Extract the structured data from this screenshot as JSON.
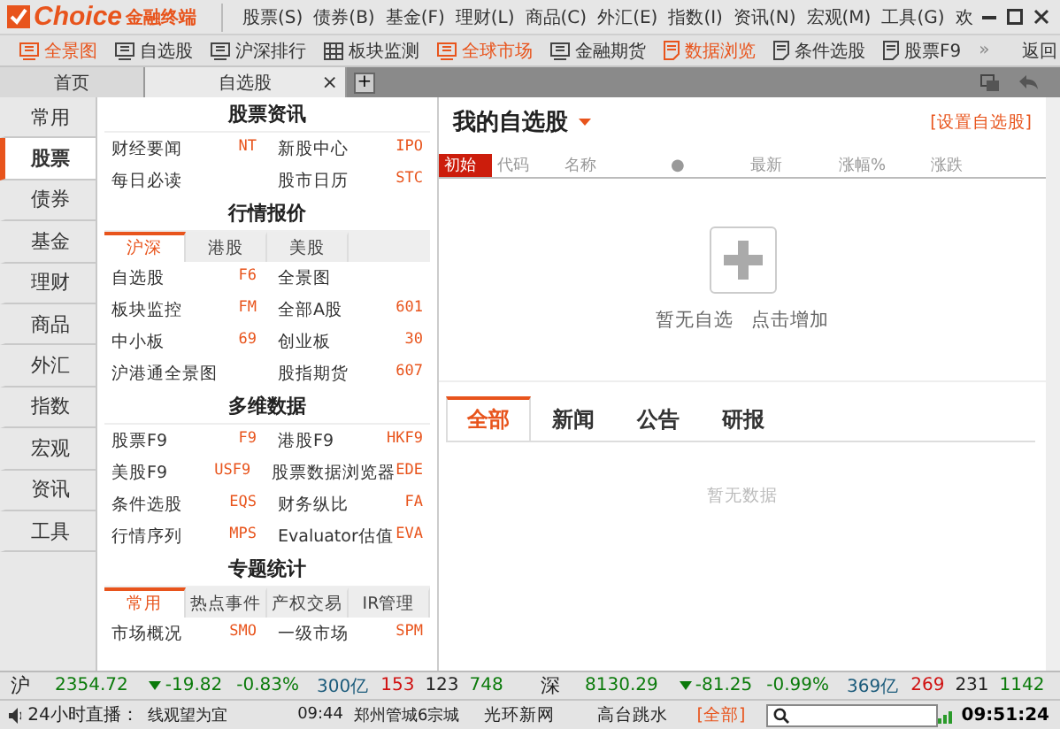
{
  "logo": {
    "brand": "Choice",
    "product": "金融终端"
  },
  "menu": [
    "股票(S)",
    "债券(B)",
    "基金(F)",
    "理财(L)",
    "商品(C)",
    "外汇(E)",
    "指数(I)",
    "资讯(N)",
    "宏观(M)",
    "工具(G)",
    "欢"
  ],
  "toolbar": [
    {
      "label": "全景图",
      "highlighted": true,
      "kind": "monitor"
    },
    {
      "label": "自选股",
      "highlighted": false,
      "kind": "monitor"
    },
    {
      "label": "沪深排行",
      "highlighted": false,
      "kind": "monitor"
    },
    {
      "label": "板块监测",
      "highlighted": false,
      "kind": "grid"
    },
    {
      "label": "全球市场",
      "highlighted": true,
      "kind": "monitor"
    },
    {
      "label": "金融期货",
      "highlighted": false,
      "kind": "monitor"
    },
    {
      "label": "数据浏览",
      "highlighted": true,
      "kind": "doc"
    },
    {
      "label": "条件选股",
      "highlighted": false,
      "kind": "doc"
    },
    {
      "label": "股票F9",
      "highlighted": false,
      "kind": "doc"
    }
  ],
  "toolbar_more": "»",
  "toolbar_back": "返回",
  "tabs": [
    {
      "label": "首页",
      "selected": false,
      "closable": false
    },
    {
      "label": "自选股",
      "selected": true,
      "closable": true
    }
  ],
  "tab_close": "×",
  "tab_add": "+",
  "sidebar": {
    "items": [
      {
        "label": "常用",
        "selected": false
      },
      {
        "label": "股票",
        "selected": true
      },
      {
        "label": "债券",
        "selected": false
      },
      {
        "label": "基金",
        "selected": false
      },
      {
        "label": "理财",
        "selected": false
      },
      {
        "label": "商品",
        "selected": false
      },
      {
        "label": "外汇",
        "selected": false
      },
      {
        "label": "指数",
        "selected": false
      },
      {
        "label": "宏观",
        "selected": false
      },
      {
        "label": "资讯",
        "selected": false
      },
      {
        "label": "工具",
        "selected": false
      }
    ]
  },
  "sections": [
    {
      "title": "股票资讯",
      "rows": [
        [
          {
            "label": "财经要闻",
            "code": "NT"
          },
          {
            "label": "新股中心",
            "code": "IPO"
          }
        ],
        [
          {
            "label": "每日必读"
          },
          {
            "label": "股市日历",
            "code": "STC"
          }
        ]
      ]
    },
    {
      "title": "行情报价",
      "tabs": [
        {
          "label": "沪深",
          "selected": true
        },
        {
          "label": "港股",
          "selected": false
        },
        {
          "label": "美股",
          "selected": false
        }
      ],
      "rows": [
        [
          {
            "label": "自选股",
            "code": "F6"
          },
          {
            "label": "全景图"
          }
        ],
        [
          {
            "label": "板块监控",
            "code": "FM"
          },
          {
            "label": "全部A股",
            "code": "601"
          }
        ],
        [
          {
            "label": "中小板",
            "code": "69"
          },
          {
            "label": "创业板",
            "code": "30"
          }
        ],
        [
          {
            "label": "沪港通全景图"
          },
          {
            "label": "股指期货",
            "code": "607"
          }
        ]
      ]
    },
    {
      "title": "多维数据",
      "rows": [
        [
          {
            "label": "股票F9",
            "code": "F9"
          },
          {
            "label": "港股F9",
            "code": "HKF9"
          }
        ],
        [
          {
            "label": "美股F9",
            "code": "USF9"
          },
          {
            "label": "股票数据浏览器",
            "code": "EDE"
          }
        ],
        [
          {
            "label": "条件选股",
            "code": "EQS"
          },
          {
            "label": "财务纵比",
            "code": "FA"
          }
        ],
        [
          {
            "label": "行情序列",
            "code": "MPS"
          },
          {
            "label": "Evaluator估值",
            "code": "EVA"
          }
        ]
      ]
    },
    {
      "title": "专题统计",
      "tabs": [
        {
          "label": "常用",
          "selected": true
        },
        {
          "label": "热点事件",
          "selected": false
        },
        {
          "label": "产权交易",
          "selected": false
        },
        {
          "label": "IR管理",
          "selected": false
        }
      ],
      "rows": [
        [
          {
            "label": "市场概况",
            "code": "SMO"
          },
          {
            "label": "一级市场",
            "code": "SPM"
          }
        ]
      ]
    }
  ],
  "watchlist": {
    "title": "我的自选股",
    "settings_link": "[设置自选股]",
    "columns": [
      {
        "label": "初始",
        "selected": true
      },
      {
        "label": "代码",
        "selected": false
      },
      {
        "label": "名称",
        "selected": false
      },
      {
        "label": "●",
        "selected": false
      },
      {
        "label": "最新",
        "selected": false
      },
      {
        "label": "涨幅%",
        "selected": false
      },
      {
        "label": "涨跌",
        "selected": false
      }
    ],
    "empty_text": "暂无自选",
    "add_text": "点击增加"
  },
  "news": {
    "tabs": [
      {
        "label": "全部",
        "selected": true
      },
      {
        "label": "新闻",
        "selected": false
      },
      {
        "label": "公告",
        "selected": false
      },
      {
        "label": "研报",
        "selected": false
      }
    ],
    "empty_text": "暂无数据"
  },
  "indices": [
    {
      "market": "沪",
      "value": "2354.72",
      "change": "-19.82",
      "percent": "-0.83%",
      "turnover": "300亿",
      "up": "153",
      "flat": "123",
      "down": "748"
    },
    {
      "market": "深",
      "value": "8130.29",
      "change": "-81.25",
      "percent": "-0.99%",
      "turnover": "369亿",
      "up": "269",
      "flat": "231",
      "down": "1142"
    }
  ],
  "status_bar": {
    "live_label": "24小时直播：",
    "live_text": "线观望为宜",
    "news_time": "09:44",
    "news_text": "郑州管城6宗城",
    "hot": [
      "光环新网",
      "高台跳水"
    ],
    "all_link": "[全部]",
    "clock": "09:51:24"
  }
}
